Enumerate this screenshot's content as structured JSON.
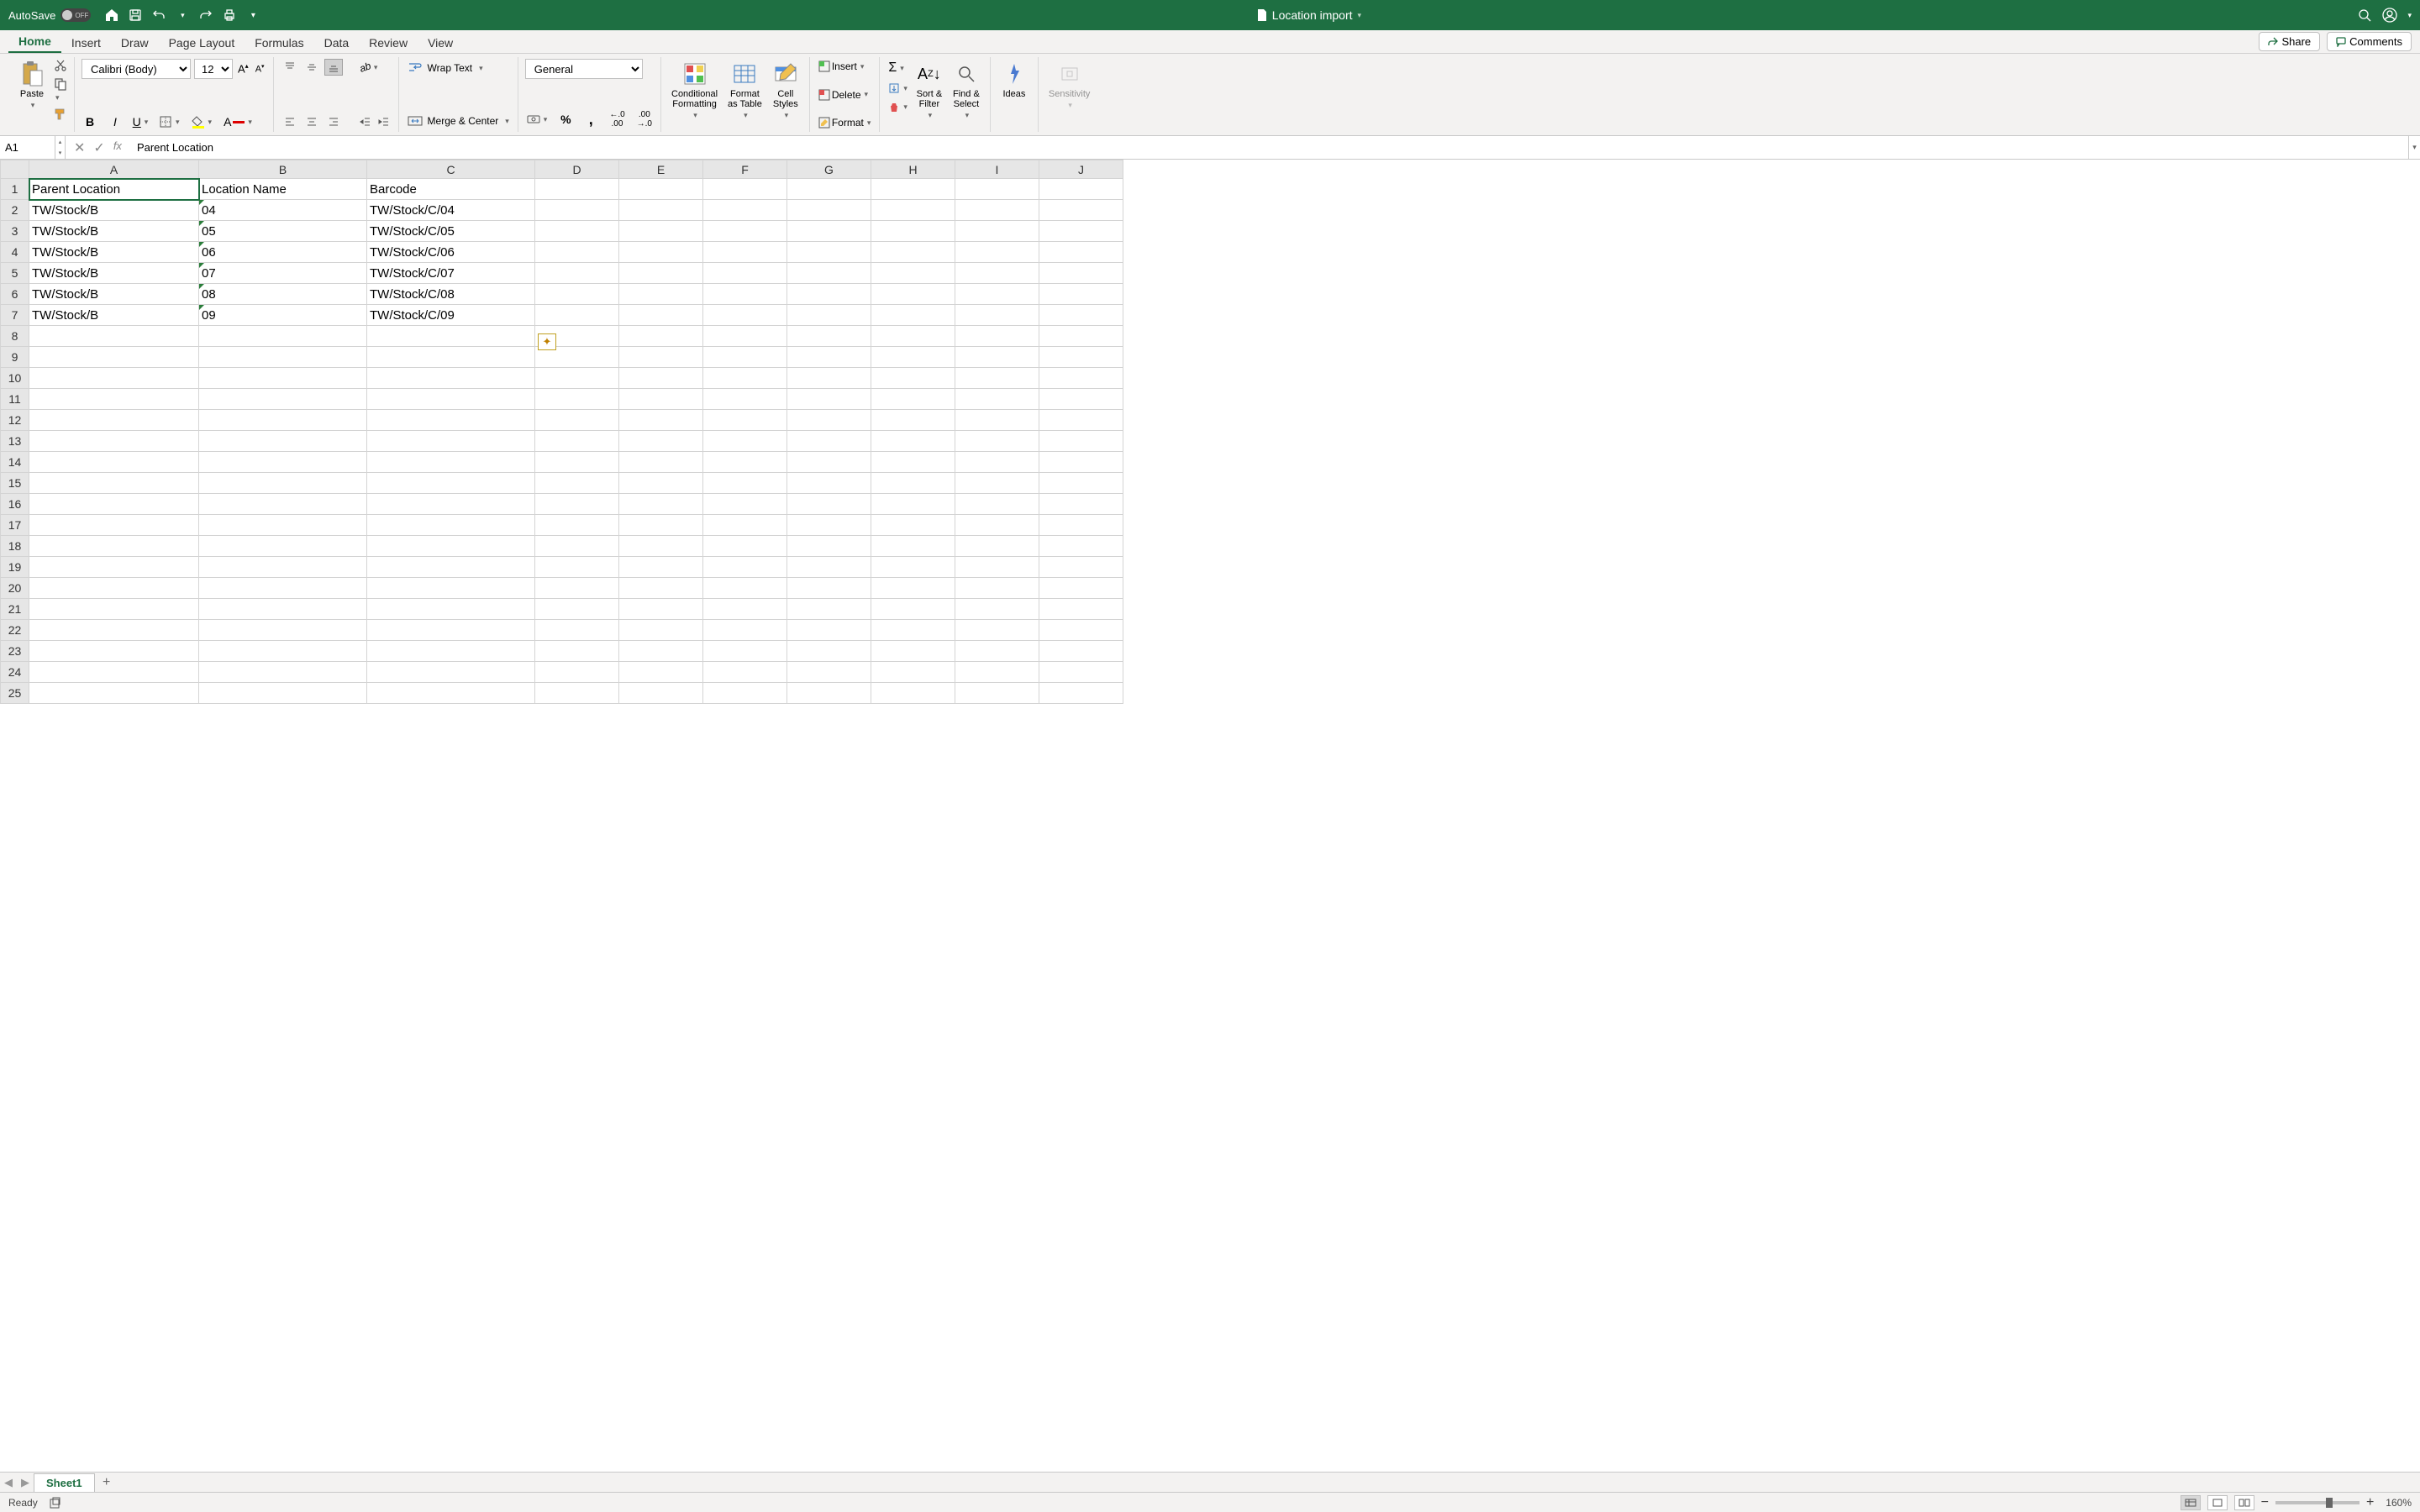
{
  "titlebar": {
    "autosave_label": "AutoSave",
    "autosave_state": "OFF",
    "doc_title": "Location import"
  },
  "tabs": {
    "items": [
      "Home",
      "Insert",
      "Draw",
      "Page Layout",
      "Formulas",
      "Data",
      "Review",
      "View"
    ],
    "active": 0,
    "share": "Share",
    "comments": "Comments"
  },
  "ribbon": {
    "paste": "Paste",
    "font_name": "Calibri (Body)",
    "font_size": "12",
    "wrap_text": "Wrap Text",
    "merge_center": "Merge & Center",
    "number_format": "General",
    "cond_fmt": "Conditional\nFormatting",
    "fmt_table": "Format\nas Table",
    "cell_styles": "Cell\nStyles",
    "insert": "Insert",
    "delete": "Delete",
    "format": "Format",
    "sort_filter": "Sort &\nFilter",
    "find_select": "Find &\nSelect",
    "ideas": "Ideas",
    "sensitivity": "Sensitivity"
  },
  "formula_bar": {
    "cell_ref": "A1",
    "content": "Parent Location"
  },
  "grid": {
    "columns": [
      "A",
      "B",
      "C",
      "D",
      "E",
      "F",
      "G",
      "H",
      "I",
      "J"
    ],
    "headers": [
      "Parent Location",
      "Location Name",
      "Barcode"
    ],
    "rows": [
      {
        "a": "TW/Stock/B",
        "b": "04",
        "c": "TW/Stock/C/04"
      },
      {
        "a": "TW/Stock/B",
        "b": "05",
        "c": "TW/Stock/C/05"
      },
      {
        "a": "TW/Stock/B",
        "b": "06",
        "c": "TW/Stock/C/06"
      },
      {
        "a": "TW/Stock/B",
        "b": "07",
        "c": "TW/Stock/C/07"
      },
      {
        "a": "TW/Stock/B",
        "b": "08",
        "c": "TW/Stock/C/08"
      },
      {
        "a": "TW/Stock/B",
        "b": "09",
        "c": "TW/Stock/C/09"
      }
    ],
    "visible_rows": 25,
    "selected_cell": "A1"
  },
  "sheet_tabs": {
    "active": "Sheet1"
  },
  "statusbar": {
    "status": "Ready",
    "zoom": "160%"
  }
}
